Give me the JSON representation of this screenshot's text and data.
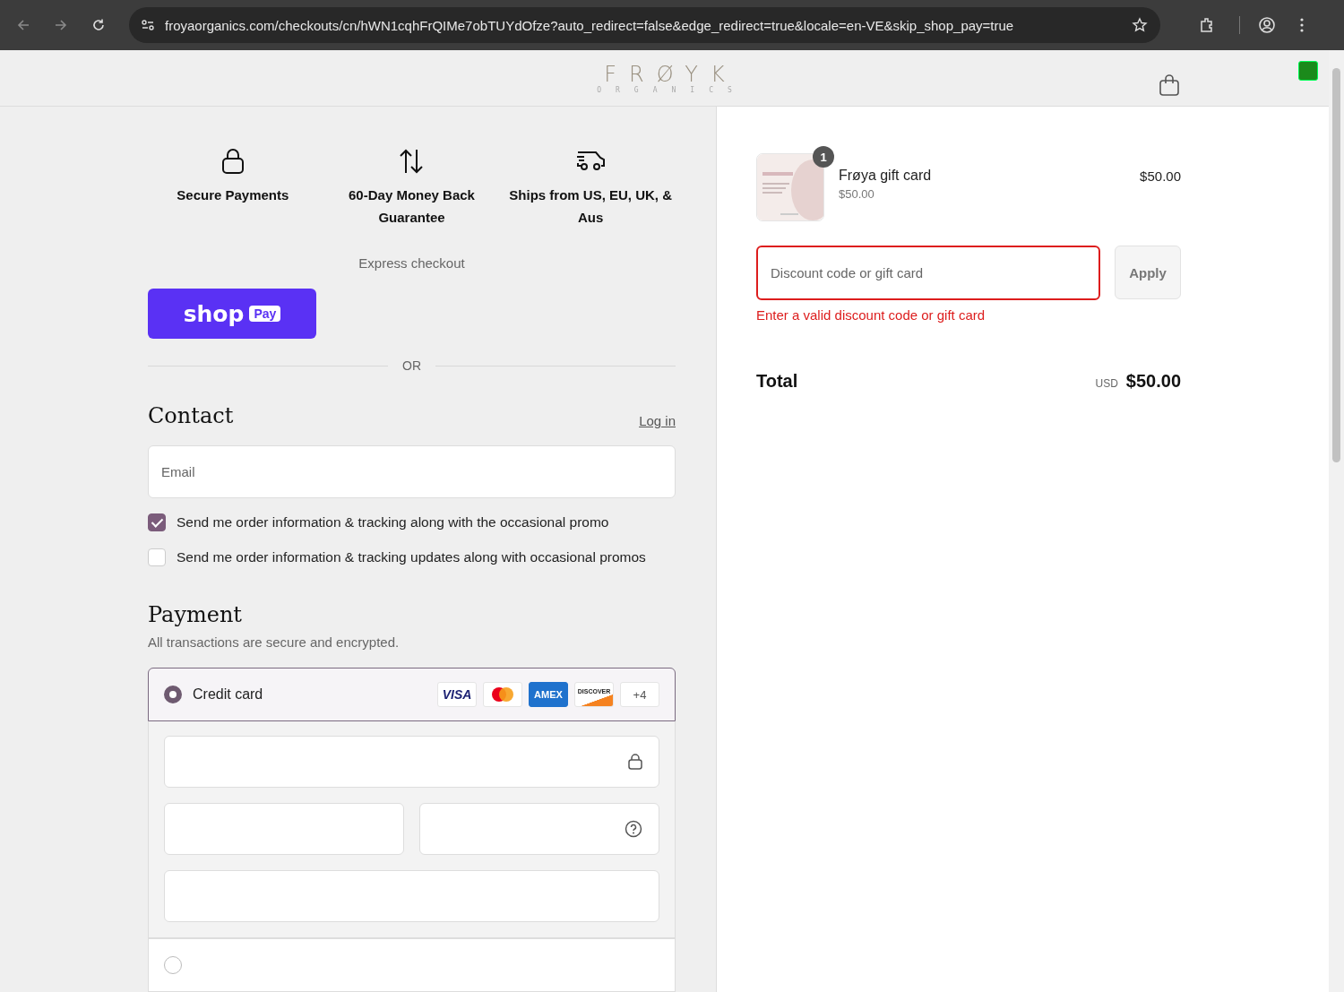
{
  "browser": {
    "url": "froyaorganics.com/checkouts/cn/hWN1cqhFrQIMe7obTUYdOfze?auto_redirect=false&edge_redirect=true&locale=en-VE&skip_shop_pay=true"
  },
  "header": {
    "logo": "FRØYK",
    "logo_subtitle": "ORGANICS"
  },
  "trust_badges": [
    {
      "kind": "lock",
      "label": "Secure Payments"
    },
    {
      "kind": "arrows",
      "label": "60-Day Money Back Guarantee"
    },
    {
      "kind": "truck",
      "label": "Ships from US, EU, UK, & Aus"
    }
  ],
  "express_checkout": {
    "label": "Express checkout",
    "shop_pay": {
      "wordmark": "shop",
      "badge": "Pay"
    },
    "divider": "OR"
  },
  "contact": {
    "title": "Contact",
    "login_link": "Log in",
    "email": {
      "placeholder": "Email"
    },
    "options": [
      {
        "label": "Send me order information & tracking along with the occasional promo",
        "checked": true
      },
      {
        "label": "Send me order information & tracking updates along with occasional promos",
        "checked": false
      }
    ]
  },
  "payment": {
    "title": "Payment",
    "subtitle": "All transactions are secure and encrypted.",
    "methods": [
      {
        "label": "Credit card",
        "selected": true
      },
      {
        "selected": false
      }
    ],
    "card_brands": [
      {
        "kind": "visa",
        "label": "VISA"
      },
      {
        "kind": "mastercard"
      },
      {
        "kind": "amex",
        "label": "AMEX"
      },
      {
        "kind": "discover",
        "label": "DISCOVER"
      },
      {
        "kind": "more",
        "label": "+4"
      }
    ],
    "card_fields": [
      {
        "kind": "number"
      },
      {
        "kind": "expiry"
      },
      {
        "kind": "cvc"
      },
      {
        "kind": "name"
      }
    ]
  },
  "summary": {
    "items": [
      {
        "quantity": "1",
        "name": "Frøya gift card",
        "unit_price": "$50.00",
        "price": "$50.00"
      }
    ],
    "discount": {
      "placeholder": "Discount code or gift card",
      "button": "Apply",
      "error": "Enter a valid discount code or gift card"
    },
    "total": {
      "label": "Total",
      "currency": "USD",
      "amount": "$50.00"
    }
  }
}
